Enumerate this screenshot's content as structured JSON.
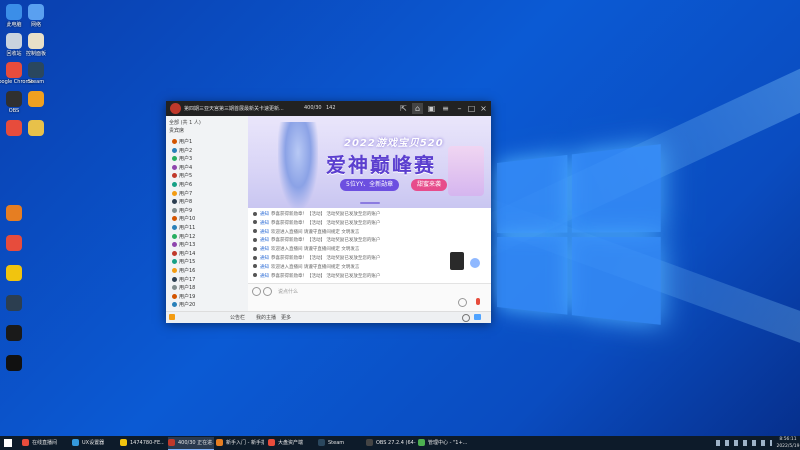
{
  "desktop": {
    "icons": [
      {
        "label": "此电脑",
        "color": "#3b8ee8"
      },
      {
        "label": "网络",
        "color": "#5aa0f0"
      },
      {
        "label": "回收站",
        "color": "#c9d3de"
      },
      {
        "label": "控制面板",
        "color": "#e8e0c8"
      },
      {
        "label": "Google Chrome",
        "color": "#e74c3c"
      },
      {
        "label": "Steam",
        "color": "#2a475e"
      },
      {
        "label": "OBS",
        "color": "#303030"
      },
      {
        "label": "",
        "color": "#f0a020"
      },
      {
        "label": "",
        "color": "#e74c3c"
      },
      {
        "label": "",
        "color": "#e8c14a"
      }
    ]
  },
  "window": {
    "title": "第四期三亚天宫第三期首展最新关卡速更新...",
    "counter1": "400/30",
    "counter2": "142",
    "sidebar": {
      "heading": "全部 (共 1 人)",
      "subheading": "贵宾席",
      "users": [
        {
          "name": "用户1",
          "extra": "",
          "color": "#d35400"
        },
        {
          "name": "用户2",
          "extra": "",
          "color": "#2980b9"
        },
        {
          "name": "用户3",
          "extra": "",
          "color": "#27ae60"
        },
        {
          "name": "用户4",
          "extra": "",
          "color": "#8e44ad"
        },
        {
          "name": "用户5",
          "extra": "",
          "color": "#c0392b"
        },
        {
          "name": "用户6",
          "extra": "",
          "color": "#16a085"
        },
        {
          "name": "用户7",
          "extra": "",
          "color": "#f39c12"
        },
        {
          "name": "用户8",
          "extra": "",
          "color": "#2c3e50"
        },
        {
          "name": "用户9",
          "extra": "",
          "color": "#7f8c8d"
        },
        {
          "name": "用户10",
          "extra": "",
          "color": "#d35400"
        },
        {
          "name": "用户11",
          "extra": "",
          "color": "#2980b9"
        },
        {
          "name": "用户12",
          "extra": "",
          "color": "#27ae60"
        },
        {
          "name": "用户13",
          "extra": "",
          "color": "#8e44ad"
        },
        {
          "name": "用户14",
          "extra": "",
          "color": "#c0392b"
        },
        {
          "name": "用户15",
          "extra": "",
          "color": "#16a085"
        },
        {
          "name": "用户16",
          "extra": "",
          "color": "#f39c12"
        },
        {
          "name": "用户17",
          "extra": "",
          "color": "#2c3e50"
        },
        {
          "name": "用户18",
          "extra": "",
          "color": "#7f8c8d"
        },
        {
          "name": "用户19",
          "extra": "",
          "color": "#d35400"
        },
        {
          "name": "用户20",
          "extra": "",
          "color": "#2980b9"
        }
      ]
    },
    "banner": {
      "line1": "2022游戏宝贝520",
      "line2": "爱神巅峰赛",
      "pill1": "5位YY、全新勋章",
      "pill2": "甜蜜来袭"
    },
    "chat": [
      {
        "user": "通知",
        "text": "恭喜获得新勋章！【活动】 活动奖励已发放至您的账户"
      },
      {
        "user": "通知",
        "text": "恭喜获得新勋章！【活动】 活动奖励已发放至您的账户"
      },
      {
        "user": "通知",
        "text": "欢迎进入直播间 请遵守直播间规定 文明发言"
      },
      {
        "user": "通知",
        "text": "恭喜获得新勋章！【活动】 活动奖励已发放至您的账户"
      },
      {
        "user": "通知",
        "text": "欢迎进入直播间 请遵守直播间规定 文明发言"
      },
      {
        "user": "通知",
        "text": "恭喜获得新勋章！【活动】 活动奖励已发放至您的账户"
      },
      {
        "user": "通知",
        "text": "欢迎进入直播间 请遵守直播间规定 文明发言"
      },
      {
        "user": "通知",
        "text": "恭喜获得新勋章！【活动】 活动奖励已发放至您的账户"
      }
    ],
    "input_placeholder": "说点什么",
    "statusbar": [
      "公告栏",
      "我的主播",
      "更多"
    ]
  },
  "taskbar": {
    "items": [
      {
        "label": "在线直播间",
        "color": "#e74c3c",
        "active": false
      },
      {
        "label": "UX设置器",
        "color": "#3498db",
        "active": false
      },
      {
        "label": "1474780-FE...",
        "color": "#f1c40f",
        "active": false
      },
      {
        "label": "400/30 正在进...",
        "color": "#c0392b",
        "active": true
      },
      {
        "label": "新手入门 - 新手指南",
        "color": "#e67e22",
        "active": false
      },
      {
        "label": "大盘资产端",
        "color": "#e74c3c",
        "active": false
      },
      {
        "label": "Steam",
        "color": "#2a475e",
        "active": false
      },
      {
        "label": "OBS 27.2.4 (64-b...",
        "color": "#444",
        "active": false
      },
      {
        "label": "管理中心 - \"1+...",
        "color": "#4caf50",
        "active": false
      }
    ],
    "time": "8:56:11",
    "date": "2022/5/19"
  }
}
